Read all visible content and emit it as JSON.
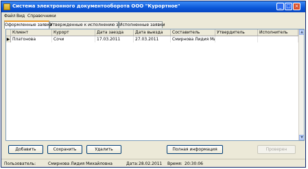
{
  "window": {
    "title": "Система электронного документооборота ООО \"Курортное\"",
    "controls": {
      "minimize": "_",
      "maximize": "□",
      "close": "×"
    }
  },
  "menu": [
    "Файл",
    "Вид",
    "Справочники"
  ],
  "tabs": [
    {
      "label": "Оформленные заявки",
      "active": true
    },
    {
      "label": "Утвержденные к исполнению заявки",
      "active": false
    },
    {
      "label": "Исполненные заявки",
      "active": false
    }
  ],
  "table": {
    "columns": [
      "Клиент",
      "Курорт",
      "Дата заезда",
      "Дата выезда",
      "Составитель",
      "Утвердитель",
      "Исполнитель"
    ],
    "rows": [
      {
        "indicator": "▶",
        "cells": [
          "Платонова",
          "Сочи",
          "17.03.2011",
          "27.03.2011",
          "Смирнова Лидия Михай",
          "",
          ""
        ]
      }
    ]
  },
  "buttons": {
    "add": "Добавить",
    "save": "Сохранить",
    "delete": "Удалить",
    "full_info": "Полная информация",
    "checked": "Проверен"
  },
  "status": {
    "user_label": "Пользователь:",
    "user_value": "Смирнова Лидия Михайловна",
    "date_label": "Дата:",
    "date_value": "28.02.2011",
    "time_label": "Время:",
    "time_value": "20:30:06"
  },
  "colors": {
    "titlebar": "#0a56d8",
    "active_tab_accent": "#e69a2e",
    "window_bg": "#ece9d8"
  }
}
